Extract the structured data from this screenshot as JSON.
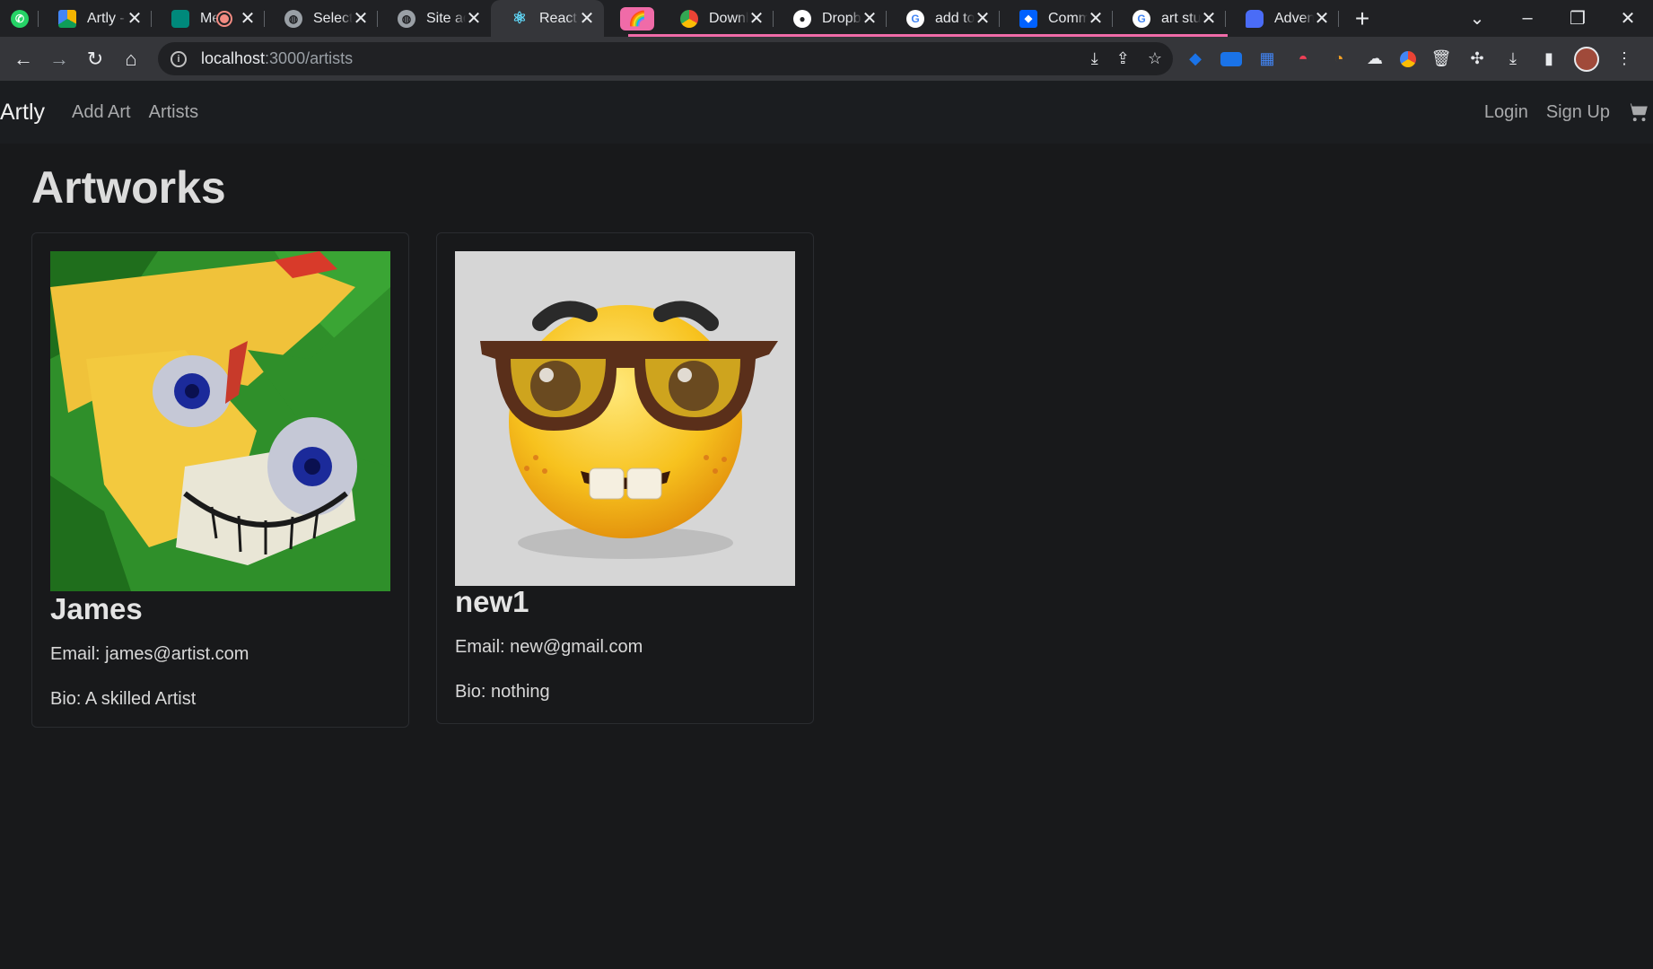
{
  "browser": {
    "tabs": [
      {
        "title": "",
        "favicon": "whatsapp-icon",
        "color": "#25d366"
      },
      {
        "title": "Artly -",
        "favicon": "google-drive-icon",
        "color": "#f4b400"
      },
      {
        "title": "Me",
        "favicon": "google-meet-icon",
        "color": "#00897b"
      },
      {
        "title": "Select",
        "favicon": "globe-icon",
        "color": "#9aa0a6"
      },
      {
        "title": "Site ad",
        "favicon": "globe-icon",
        "color": "#9aa0a6"
      },
      {
        "title": "React A",
        "favicon": "react-icon",
        "color": "#61dafb"
      },
      {
        "title": "",
        "favicon": "rainbow-icon",
        "color": "#f06ba8"
      },
      {
        "title": "Downl",
        "favicon": "chrome-icon",
        "color": "#ea4335"
      },
      {
        "title": "Dropb",
        "favicon": "github-icon",
        "color": "#ffffff"
      },
      {
        "title": "add to",
        "favicon": "google-icon",
        "color": "#4285f4"
      },
      {
        "title": "Comm",
        "favicon": "dropbox-icon",
        "color": "#0061ff"
      },
      {
        "title": "art stu",
        "favicon": "google-icon",
        "color": "#4285f4"
      },
      {
        "title": "Advent",
        "favicon": "doc-icon",
        "color": "#4a6cf7"
      }
    ],
    "url_host": "localhost",
    "url_path": ":3000/artists"
  },
  "nav": {
    "brand": "Artly",
    "add_art": "Add Art",
    "artists": "Artists",
    "login": "Login",
    "signup": "Sign Up"
  },
  "page": {
    "title": "Artworks"
  },
  "artists": [
    {
      "name": "James",
      "email": "Email: james@artist.com",
      "bio": "Bio: A skilled Artist"
    },
    {
      "name": "new1",
      "email": "Email: new@gmail.com",
      "bio": "Bio: nothing"
    }
  ],
  "colors": {
    "background": "#18191b",
    "navbar": "#1b1d20",
    "muted_link": "#a8a9ab",
    "tab_underline": "#f06ba8"
  }
}
